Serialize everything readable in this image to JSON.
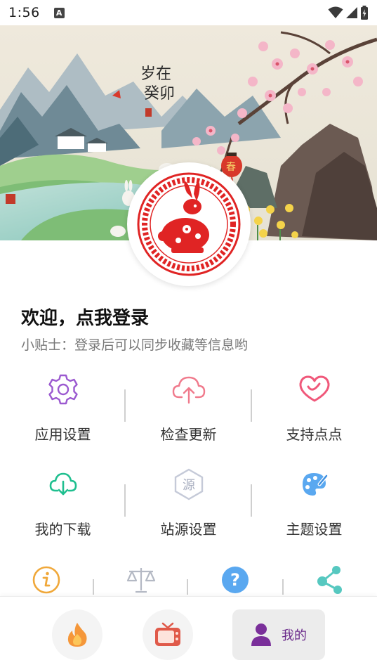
{
  "status_bar": {
    "time": "1:56",
    "notification_icon": "A"
  },
  "banner": {
    "calligraphy": "岁在癸卯",
    "lantern_text": "春"
  },
  "profile": {
    "welcome": "欢迎，点我登录",
    "tip": "小贴士：登录后可以同步收藏等信息哟"
  },
  "menu": {
    "row1": [
      {
        "label": "应用设置",
        "icon": "gear-icon",
        "color": "#9b59d0"
      },
      {
        "label": "检查更新",
        "icon": "cloud-upload-icon",
        "color": "#f07a8c"
      },
      {
        "label": "支持点点",
        "icon": "heart-icon",
        "color": "#f0587a"
      }
    ],
    "row2": [
      {
        "label": "我的下载",
        "icon": "cloud-download-icon",
        "color": "#1fbf8f"
      },
      {
        "label": "站源设置",
        "icon": "source-icon",
        "color": "#b0b6c8",
        "glyph": "源"
      },
      {
        "label": "主题设置",
        "icon": "palette-icon",
        "color": "#5aa8f0"
      }
    ],
    "row3_icons": [
      "info-icon",
      "scales-icon",
      "help-icon",
      "share-icon"
    ]
  },
  "bottom_nav": {
    "items": [
      {
        "icon": "fire-icon"
      },
      {
        "icon": "tv-icon"
      },
      {
        "icon": "person-icon",
        "label": "我的"
      }
    ]
  },
  "colors": {
    "accent": "#7a2f9a",
    "rabbit_red": "#e02424"
  }
}
